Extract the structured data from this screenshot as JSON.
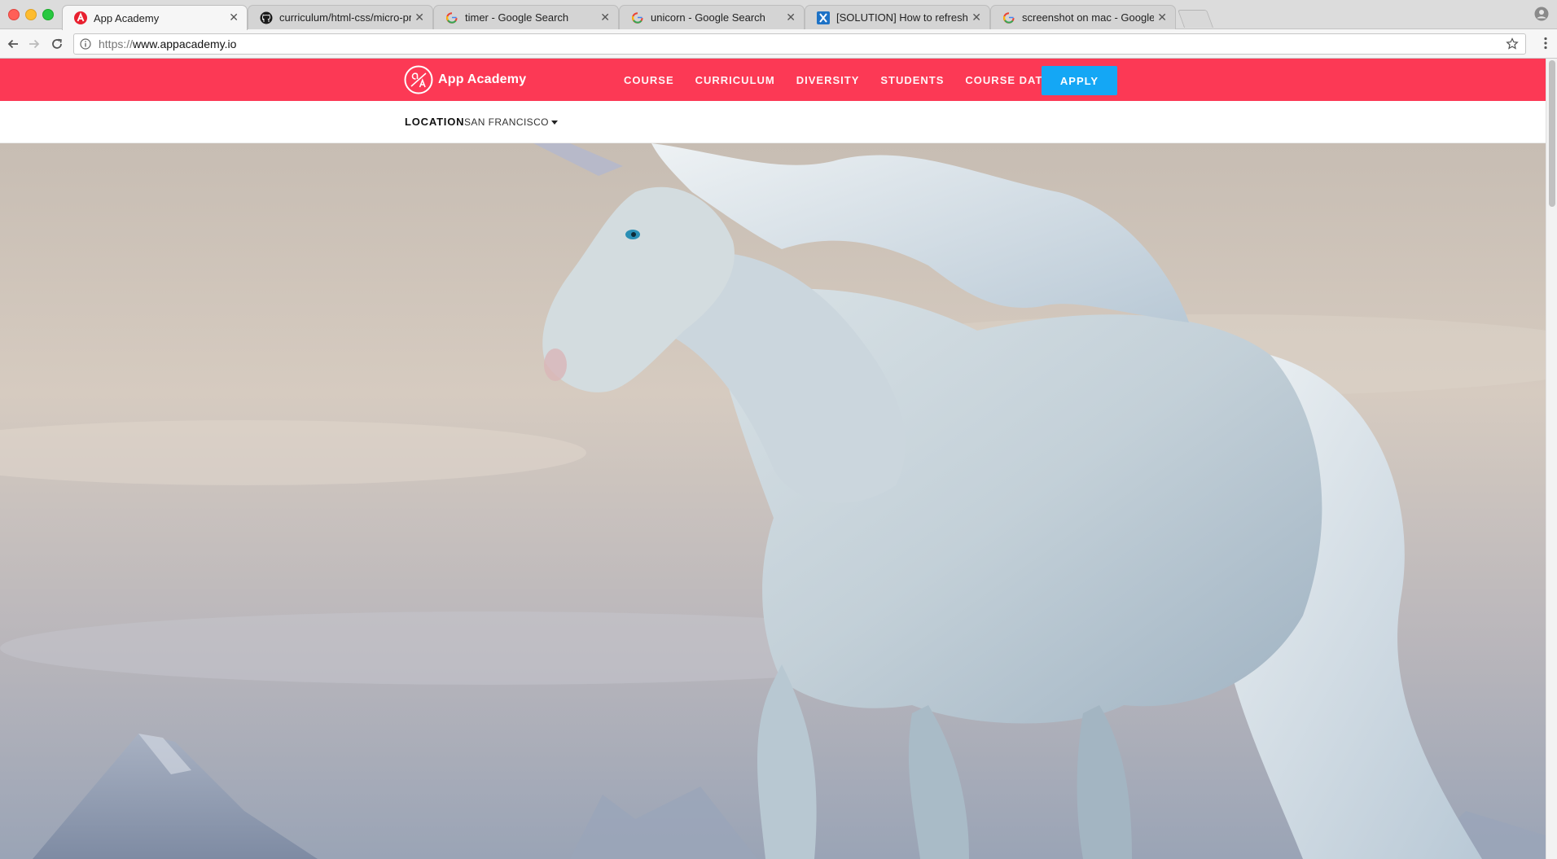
{
  "browser": {
    "tabs": [
      {
        "title": "App Academy",
        "favicon": "app-academy-icon",
        "active": true
      },
      {
        "title": "curriculum/html-css/micro-pro",
        "favicon": "github-icon",
        "active": false
      },
      {
        "title": "timer - Google Search",
        "favicon": "google-icon",
        "active": false
      },
      {
        "title": "unicorn - Google Search",
        "favicon": "google-icon",
        "active": false
      },
      {
        "title": "[SOLUTION] How to refresh a",
        "favicon": "x-icon",
        "active": false
      },
      {
        "title": "screenshot on mac - Google S",
        "favicon": "google-icon",
        "active": false
      }
    ],
    "url": {
      "scheme": "https://",
      "host": "www.appacademy.io"
    }
  },
  "site": {
    "brand": "App Academy",
    "nav": [
      "COURSE",
      "CURRICULUM",
      "DIVERSITY",
      "STUDENTS",
      "COURSE DATES"
    ],
    "apply_label": "APPLY",
    "location_label": "LOCATION",
    "location_value": "SAN FRANCISCO"
  },
  "colors": {
    "brand_red": "#fc3955",
    "apply_blue": "#14a7f5"
  }
}
